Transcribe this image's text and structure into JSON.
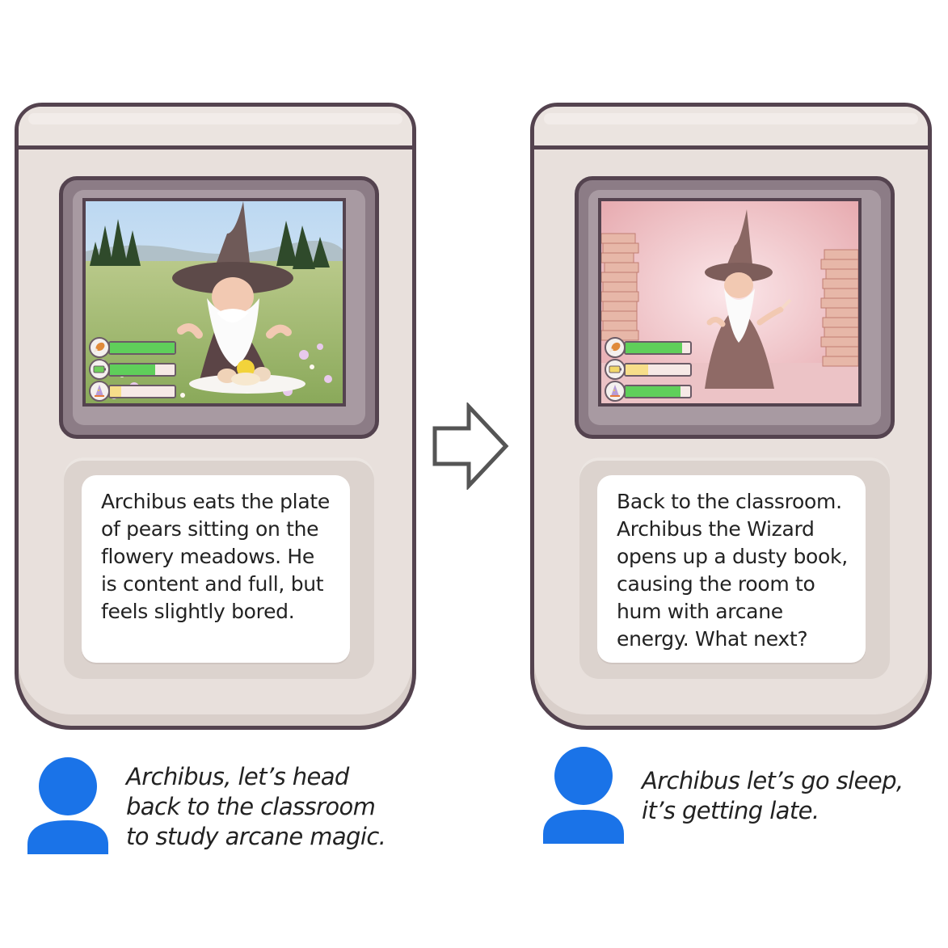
{
  "panels": [
    {
      "scene": "flowery-meadow",
      "narration": [
        "Archibus eats the plate",
        "of pears sitting on the",
        "flowery meadows. He",
        "is content and full, but",
        "feels slightly bored."
      ],
      "stats": [
        {
          "icon": "drumstick-icon",
          "level": 1.0,
          "color": "#5fcf5a"
        },
        {
          "icon": "battery-icon",
          "level": 0.7,
          "color": "#5fcf5a"
        },
        {
          "icon": "wizard-hat-icon",
          "level": 0.18,
          "color": "#f7de8a"
        }
      ],
      "user_message": [
        "Archibus, let’s head",
        "back to the classroom",
        "to study arcane magic."
      ]
    },
    {
      "scene": "classroom",
      "narration": [
        "Back to the classroom.",
        "Archibus the Wizard",
        "opens up a dusty book,",
        "causing the room to",
        "hum with arcane",
        "energy. What next?"
      ],
      "stats": [
        {
          "icon": "drumstick-icon",
          "level": 0.88,
          "color": "#5fcf5a"
        },
        {
          "icon": "battery-icon",
          "level": 0.35,
          "color": "#f7de8a"
        },
        {
          "icon": "wizard-hat-icon",
          "level": 0.85,
          "color": "#5fcf5a"
        }
      ],
      "user_message": [
        "Archibus let’s go sleep,",
        "it’s getting late."
      ]
    }
  ],
  "colors": {
    "outline": "#54434f",
    "body": "#e8e0dc",
    "user_icon": "#1a73e8"
  }
}
